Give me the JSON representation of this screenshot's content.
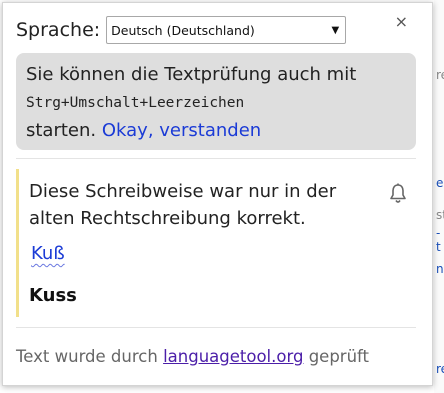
{
  "language": {
    "label": "Sprache:",
    "selected": "Deutsch (Deutschland)"
  },
  "close_glyph": "×",
  "tip": {
    "text_before": "Sie können die Textprüfung auch mit",
    "shortcut": "Strg+Umschalt+Leerzeichen",
    "text_after": "starten.",
    "ok_link": "Okay, verstanden"
  },
  "error": {
    "message": "Diese Schreibweise war nur in der alten Rechtschreibung korrekt.",
    "suggestion": "Kuß",
    "original": "Kuss",
    "accent_color": "#f2e08a"
  },
  "footer": {
    "text_before": "Text wurde durch",
    "link": "languagetool.org",
    "text_after": "geprüft"
  },
  "background_fragments": [
    "re",
    "en",
    "st",
    "-t",
    "ne",
    "re"
  ]
}
